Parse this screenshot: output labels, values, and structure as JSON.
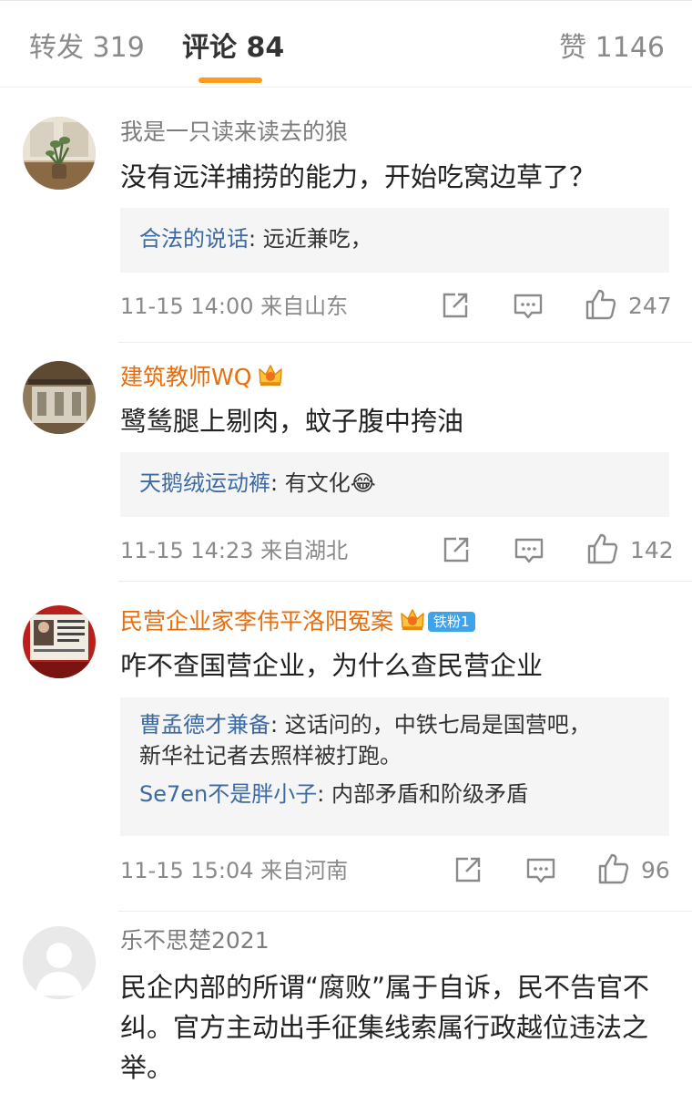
{
  "tabs": {
    "forward": "转发 319",
    "comment": "评论 84",
    "like": "赞 1146"
  },
  "comments": [
    {
      "user": "我是一只读来读去的狼",
      "text": "没有远洋捕捞的能力，开始吃窝边草了？",
      "replies": [
        {
          "name": "合法的说话",
          "text": ": 远近兼吃，"
        }
      ],
      "time": "11-15 14:00 来自山东",
      "likes": "247"
    },
    {
      "user": "建筑教师WQ",
      "text": "鹭鸶腿上剔肉，蚊子腹中挎油",
      "replies": [
        {
          "name": "天鹅绒运动裤",
          "text": ": 有文化😂"
        }
      ],
      "time": "11-15 14:23 来自湖北",
      "likes": "142"
    },
    {
      "user": "民营企业家李伟平洛阳冤案",
      "badge": "铁粉1",
      "text": "咋不查国营企业，为什么查民营企业",
      "replies": [
        {
          "name": "曹孟德才兼备",
          "text": ": 这话问的，中铁七局是国营吧，新华社记者去照样被打跑。"
        },
        {
          "name": "Se7en不是胖小子",
          "text": ": 内部矛盾和阶级矛盾"
        }
      ],
      "time": "11-15 15:04 来自河南",
      "likes": "96"
    },
    {
      "user": "乐不思楚2021",
      "text": "民企内部的所谓“腐败”属于自诉，民不告官不纠。官方主动出手征集线索属行政越位违法之举。"
    }
  ],
  "icons": {
    "forward": "share-icon",
    "comment": "comment-icon",
    "like": "thumbs-up-icon",
    "vip": "crown-icon"
  },
  "colors": {
    "accent": "#ff9a1b",
    "vip_name": "#e86d0c",
    "reply_name": "#3d6aa3",
    "badge": "#3fa3e9"
  }
}
